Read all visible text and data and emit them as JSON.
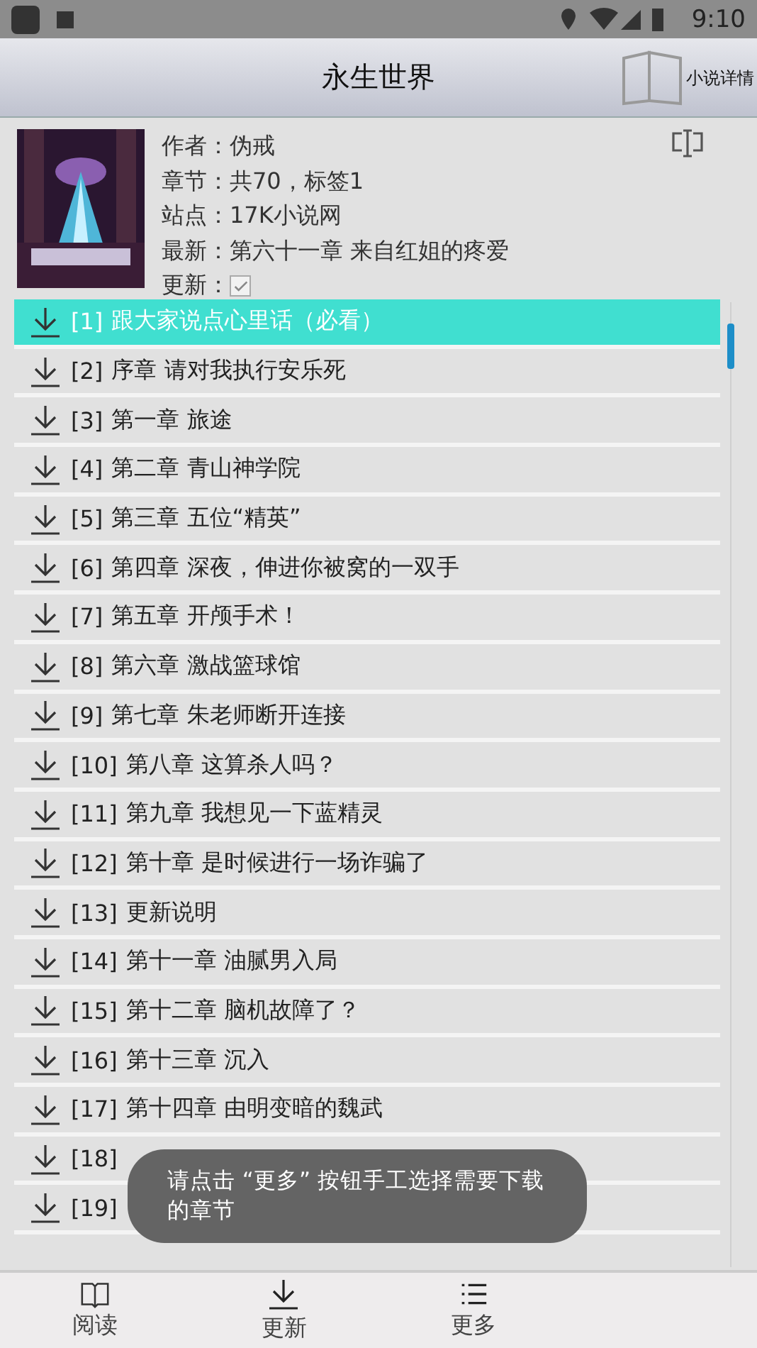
{
  "status_bar": {
    "time": "9:10"
  },
  "header": {
    "title": "永生世界",
    "detail_button": "小说详情"
  },
  "book": {
    "fields": [
      {
        "label": "作者：",
        "value": "伪戒"
      },
      {
        "label": "章节：",
        "value": "共70，标签1"
      },
      {
        "label": "站点：",
        "value": "17K小说网"
      },
      {
        "label": "最新：",
        "value": "第六十一章 来自红姐的疼爱"
      }
    ],
    "update": {
      "label": "更新：",
      "checked": true
    }
  },
  "chapters": [
    {
      "index": "[1]",
      "title": "跟大家说点心里话（必看）",
      "selected": true
    },
    {
      "index": "[2]",
      "title": "序章 请对我执行安乐死",
      "selected": false
    },
    {
      "index": "[3]",
      "title": "第一章 旅途",
      "selected": false
    },
    {
      "index": "[4]",
      "title": "第二章 青山神学院",
      "selected": false
    },
    {
      "index": "[5]",
      "title": "第三章 五位“精英”",
      "selected": false
    },
    {
      "index": "[6]",
      "title": "第四章 深夜，伸进你被窝的一双手",
      "selected": false
    },
    {
      "index": "[7]",
      "title": "第五章 开颅手术！",
      "selected": false
    },
    {
      "index": "[8]",
      "title": "第六章 激战篮球馆",
      "selected": false
    },
    {
      "index": "[9]",
      "title": "第七章 朱老师断开连接",
      "selected": false
    },
    {
      "index": "[10]",
      "title": "第八章 这算杀人吗？",
      "selected": false
    },
    {
      "index": "[11]",
      "title": "第九章 我想见一下蓝精灵",
      "selected": false
    },
    {
      "index": "[12]",
      "title": "第十章 是时候进行一场诈骗了",
      "selected": false
    },
    {
      "index": "[13]",
      "title": "更新说明",
      "selected": false
    },
    {
      "index": "[14]",
      "title": "第十一章 油腻男入局",
      "selected": false
    },
    {
      "index": "[15]",
      "title": "第十二章 脑机故障了？",
      "selected": false
    },
    {
      "index": "[16]",
      "title": "第十三章 沉入",
      "selected": false
    },
    {
      "index": "[17]",
      "title": "第十四章 由明变暗的魏武",
      "selected": false
    },
    {
      "index": "[18]",
      "selected": false
    },
    {
      "index": "[19]",
      "selected": false
    }
  ],
  "toast": "请点击 “更多” 按钮手工选择需要下载的章节",
  "bottom_nav": [
    {
      "label": "阅读",
      "kind": "read"
    },
    {
      "label": "更新",
      "kind": "update"
    },
    {
      "label": "更多",
      "kind": "more"
    }
  ]
}
